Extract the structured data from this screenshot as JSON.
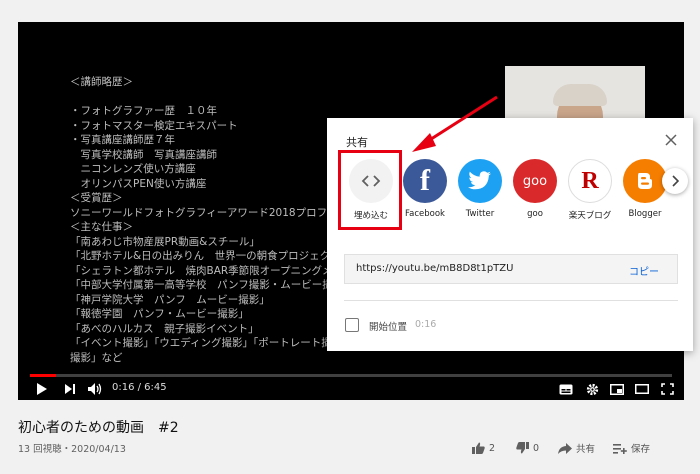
{
  "slide": {
    "lines": [
      "＜講師略歴＞",
      "",
      "・フォトグラファー歴　１０年",
      "・フォトマスター検定エキスパート",
      "・写真講座講師歴７年",
      "　写真学校講師　写真講座講師",
      "　ニコンレンズ使い方講座",
      "　オリンパスPEN使い方講座",
      "＜受賞歴＞",
      "ソニーワールドフォトグラフィーアワード2018プロフェッショナル部門",
      "＜主な仕事＞",
      "「南あわじ市物産展PR動画&スチール」",
      "「北野ホテル&日の出みりん　世界一の朝食プロジェクト」",
      "「シェラトン都ホテル　焼肉BAR季節限オープニングメニュー撮影」",
      "「中部大学付属第一高等学校　パンフ撮影・ムービー撮影」",
      "「神戸学院大学　パンフ　ムービー撮影」",
      "「報徳学園　パンフ・ムービー撮影」",
      "「あべのハルカス　親子撮影イベント」",
      "「イベント撮影」「ウエディング撮影」「ポートレート撮影」「商品",
      "撮影」など"
    ]
  },
  "player": {
    "time": "0:16 / 6:45",
    "progress_fraction": 0.04,
    "accent": "#ff0000"
  },
  "video": {
    "title": "初心者のための動画　#2",
    "meta": "13 回視聴・2020/04/13",
    "likes": "2",
    "dislikes": "0",
    "share_label": "共有",
    "save_label": "保存"
  },
  "share_dialog": {
    "title": "共有",
    "items": [
      {
        "label": "埋め込む",
        "icon": "embed-icon",
        "color": "#f2f2f2"
      },
      {
        "label": "Facebook",
        "icon": "facebook-icon",
        "color": "#3b5998"
      },
      {
        "label": "Twitter",
        "icon": "twitter-icon",
        "color": "#1da1f2"
      },
      {
        "label": "goo",
        "icon": "goo-icon",
        "color": "#d9292a"
      },
      {
        "label": "楽天ブログ",
        "icon": "rakuten-icon",
        "color": "#ffffff"
      },
      {
        "label": "Blogger",
        "icon": "blogger-icon",
        "color": "#f57d00"
      }
    ],
    "url": "https://youtu.be/mB8D8t1pTZU",
    "copy_label": "コピー",
    "start_at_label": "開始位置",
    "start_at_time": "0:16",
    "highlight_color": "#e60012"
  }
}
